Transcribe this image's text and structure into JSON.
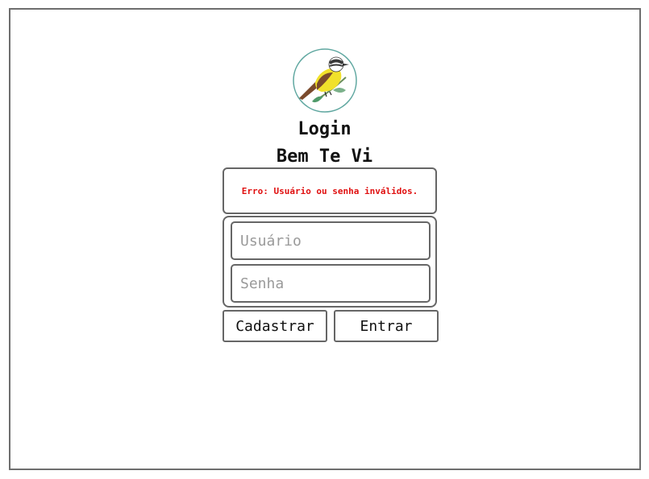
{
  "header": {
    "title": "Login",
    "app_name": "Bem Te Vi",
    "logo_icon": "bem-te-vi-bird-icon"
  },
  "error": {
    "message": "Erro: Usuário ou senha inválidos.",
    "color": "#e01010"
  },
  "form": {
    "username": {
      "value": "",
      "placeholder": "Usuário"
    },
    "password": {
      "value": "",
      "placeholder": "Senha"
    }
  },
  "actions": {
    "register_label": "Cadastrar",
    "login_label": "Entrar"
  },
  "colors": {
    "border": "#666666",
    "bird_yellow": "#f1e12b",
    "bird_brown": "#7a4a2c",
    "leaf_green": "#4f9a6a",
    "logo_ring": "#5fa7a0"
  }
}
